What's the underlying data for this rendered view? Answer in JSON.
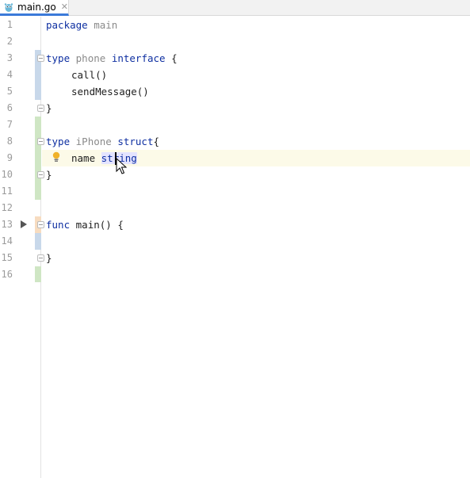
{
  "tab": {
    "filename": "main.go",
    "close": "✕"
  },
  "line_numbers": [
    "1",
    "2",
    "3",
    "4",
    "5",
    "6",
    "7",
    "8",
    "9",
    "10",
    "11",
    "12",
    "13",
    "14",
    "15",
    "16"
  ],
  "code": {
    "l1": {
      "kw": "package",
      "name": "main"
    },
    "l3": {
      "kw": "type",
      "name": "phone",
      "kw2": "interface",
      "punct": "{"
    },
    "l4": {
      "text": "call()"
    },
    "l5": {
      "text": "sendMessage()"
    },
    "l6": {
      "text": "}"
    },
    "l8": {
      "kw": "type",
      "name": "iPhone",
      "kw2": "struct",
      "punct": "{"
    },
    "l9": {
      "field": "name",
      "type_a": "st",
      "type_b": "ring"
    },
    "l10": {
      "text": "}"
    },
    "l13": {
      "kw": "func",
      "rest": "main() {"
    },
    "l15": {
      "text": "}"
    }
  },
  "colors": {
    "keyword": "#0e2fa1",
    "type_name": "#8a8a8a",
    "change_blue": "#c8d8ea",
    "change_green": "#cfe6c4",
    "change_orange": "#f7dcc0",
    "current_line": "#fcfae8",
    "tab_underline": "#3b7ad9"
  },
  "icons": [
    "gopher-file-icon",
    "run-arrow-icon",
    "intention-bulb-icon",
    "fold-marker-icon",
    "mouse-cursor-icon"
  ]
}
